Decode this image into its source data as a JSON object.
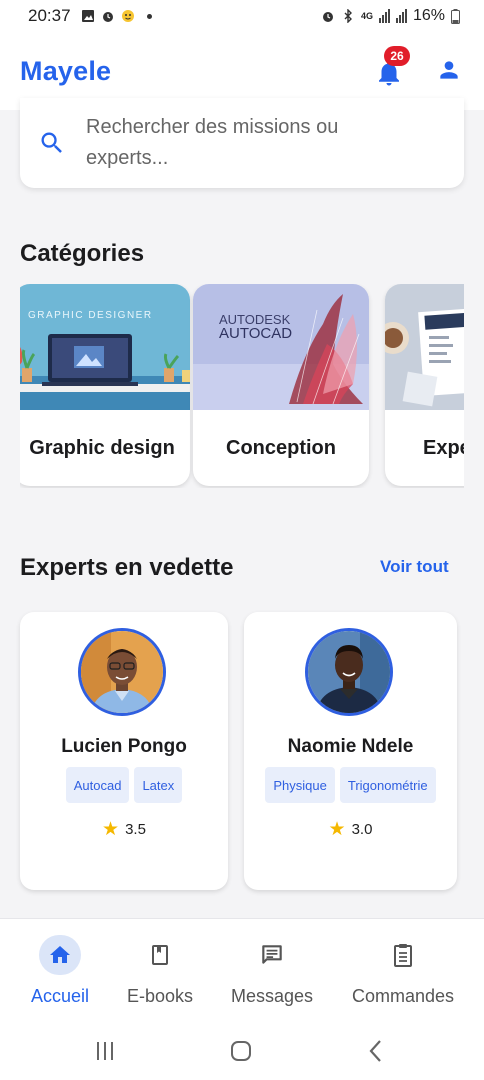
{
  "status_bar": {
    "time": "20:37",
    "battery": "16%",
    "network": "4G"
  },
  "app_bar": {
    "brand": "Mayele",
    "notifications_count": "26"
  },
  "search": {
    "placeholder_line1": "Rechercher des missions ou",
    "placeholder_line2": "experts..."
  },
  "categories": {
    "title": "Catégories",
    "items": [
      {
        "label": "Graphic design",
        "banner_text": "GRAPHIC DESIGNER"
      },
      {
        "label": "Conception",
        "banner_text_1": "AUTODESK",
        "banner_text_2": "AUTOCAD"
      },
      {
        "label": "Expe"
      }
    ]
  },
  "featured": {
    "title": "Experts en vedette",
    "see_all": "Voir tout",
    "experts": [
      {
        "name": "Lucien Pongo",
        "tags": [
          "Autocad",
          "Latex"
        ],
        "rating": "3.5"
      },
      {
        "name": "Naomie Ndele",
        "tags": [
          "Physique",
          "Trigonométrie"
        ],
        "rating": "3.0"
      }
    ]
  },
  "bottom_nav": {
    "items": [
      {
        "label": "Accueil",
        "icon": "home-icon",
        "active": true
      },
      {
        "label": "E-books",
        "icon": "book-icon",
        "active": false
      },
      {
        "label": "Messages",
        "icon": "message-icon",
        "active": false
      },
      {
        "label": "Commandes",
        "icon": "clipboard-icon",
        "active": false
      }
    ]
  },
  "colors": {
    "primary": "#2563eb",
    "badge": "#e11d2a",
    "star": "#f5b800",
    "tag_bg": "#e8eefb"
  }
}
